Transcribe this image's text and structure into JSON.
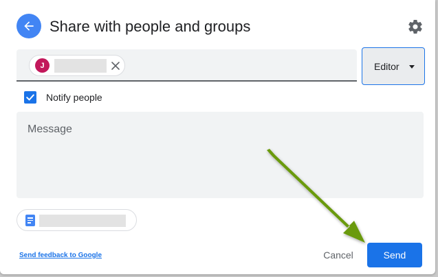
{
  "dialog": {
    "title": "Share with people and groups"
  },
  "recipients": [
    {
      "avatar_initial": "J",
      "avatar_color": "#c2185b"
    }
  ],
  "role": {
    "selected": "Editor"
  },
  "notify": {
    "label": "Notify people",
    "checked": true
  },
  "message": {
    "placeholder": "Message"
  },
  "footer": {
    "feedback_link": "Send feedback to Google",
    "cancel_label": "Cancel",
    "send_label": "Send"
  },
  "colors": {
    "accent": "#1a73e8",
    "annotation_arrow": "#6a9a0a"
  }
}
